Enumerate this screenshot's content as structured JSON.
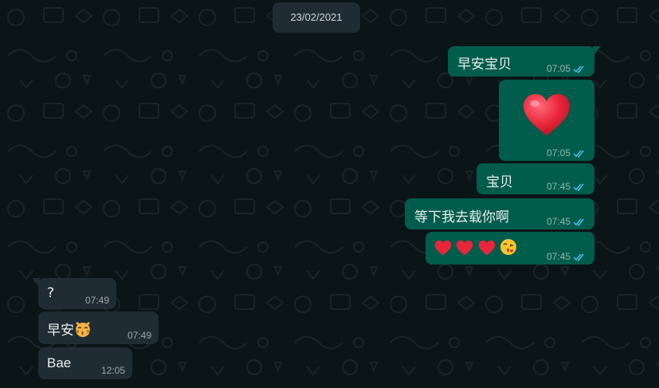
{
  "date_separator": "23/02/2021",
  "colors": {
    "background": "#0b1417",
    "outgoing_bubble": "#005c4b",
    "incoming_bubble": "#1f2c33",
    "read_ticks": "#53bdeb",
    "heart": "#e8253a"
  },
  "messages": [
    {
      "direction": "out",
      "text": "早安宝贝",
      "time": "07:05",
      "status": "read-double-check-icon"
    },
    {
      "direction": "out",
      "text": "",
      "emoji": "red-heart-icon",
      "time": "07:05",
      "status": "read-double-check-icon"
    },
    {
      "direction": "out",
      "text": "宝贝",
      "time": "07:45",
      "status": "read-double-check-icon"
    },
    {
      "direction": "out",
      "text": "等下我去载你啊",
      "time": "07:45",
      "status": "read-double-check-icon"
    },
    {
      "direction": "out",
      "text": "",
      "emoji": [
        "red-heart-icon",
        "red-heart-icon",
        "red-heart-icon",
        "kissing-face-icon"
      ],
      "time": "07:45",
      "status": "read-double-check-icon"
    },
    {
      "direction": "in",
      "text": "?",
      "time": "07:49"
    },
    {
      "direction": "in",
      "text": "早安",
      "emoji": "kissing-cat-icon",
      "time": "07:49"
    },
    {
      "direction": "in",
      "text": "Bae",
      "time": "12:05"
    }
  ]
}
